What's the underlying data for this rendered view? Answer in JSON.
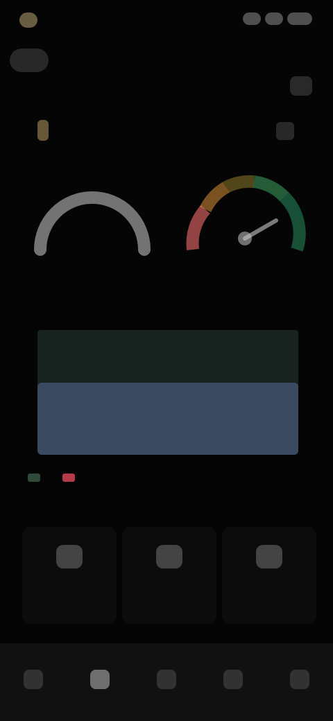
{
  "status_bar": {
    "time": "",
    "icons": [
      "signal-icon",
      "wifi-icon",
      "battery-icon"
    ]
  },
  "header": {
    "back_label": "",
    "title": "",
    "subtitle": "",
    "action_icon": "settings-icon"
  },
  "device": {
    "label": "",
    "icon": "device-icon",
    "action_icon": "chevron-icon"
  },
  "gauges": [
    {
      "value": "",
      "caption": "",
      "type": "ring",
      "color": "#bdbdbd"
    },
    {
      "value": "",
      "caption": "",
      "type": "scale",
      "colors": [
        "#e06666",
        "#f0a040",
        "#e0c040",
        "#44b36b",
        "#2a9a6a"
      ]
    }
  ],
  "chart": {
    "left_label": "",
    "right_label": "",
    "upper_color": "#18231f",
    "lower_color": "#3a4a60"
  },
  "legend": [
    {
      "label": "",
      "color": "#2f4a3a"
    },
    {
      "label": "",
      "color": "#b43a4a"
    }
  ],
  "more_link": "",
  "tiles": [
    {
      "label": "",
      "icon": "chart-icon"
    },
    {
      "label": "",
      "icon": "bell-icon"
    },
    {
      "label": "",
      "icon": "user-icon"
    }
  ],
  "nav": [
    {
      "label": "",
      "icon": "home-icon",
      "active": false
    },
    {
      "label": "",
      "icon": "chart-icon",
      "active": true
    },
    {
      "label": "",
      "icon": "device-icon",
      "active": false
    },
    {
      "label": "",
      "icon": "settings-icon",
      "active": false
    },
    {
      "label": "",
      "icon": "profile-icon",
      "active": false
    }
  ]
}
